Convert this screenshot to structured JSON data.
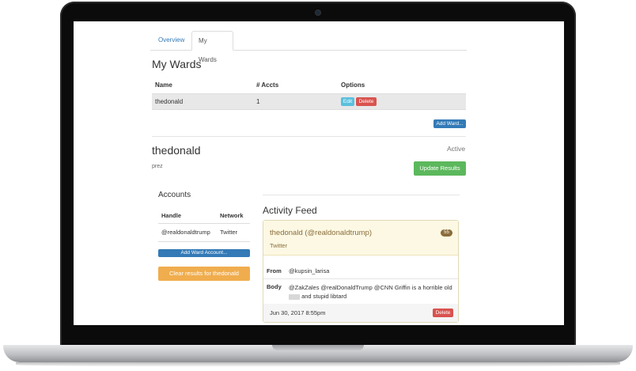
{
  "tabs": [
    {
      "label": "Overview"
    },
    {
      "label": "My Wards"
    }
  ],
  "wards": {
    "heading": "My Wards",
    "columns": [
      "Name",
      "# Accts",
      "Options"
    ],
    "rows": [
      {
        "name": "thedonald",
        "accts": "1",
        "edit_label": "Edit",
        "delete_label": "Delete"
      }
    ],
    "add_label": "Add Ward..."
  },
  "ward": {
    "title": "thedonald",
    "description": "prez",
    "status": "Active",
    "update_label": "Update Results"
  },
  "accounts": {
    "heading": "Accounts",
    "columns": [
      "Handle",
      "Network"
    ],
    "rows": [
      {
        "handle": "@realdonaldtrump",
        "network": "Twitter"
      }
    ],
    "add_label": "Add Ward Account...",
    "clear_label": "Clear results for thedonald"
  },
  "feed": {
    "heading": "Activity Feed",
    "item": {
      "title": "thedonald (@realdonaldtrump)",
      "badge": "55",
      "network": "Twitter",
      "from_label": "From",
      "from_value": "@kupsin_larisa",
      "body_label": "Body",
      "body_line1": "@ZakZales @realDonaldTrump @CNN Griffin is a horrible old",
      "body_line2": "and stupid libtard",
      "date": "Jun 30, 2017 8:55pm",
      "delete_label": "Delete"
    }
  },
  "colors": {
    "primary": "#337ab7",
    "info": "#5bc0de",
    "danger": "#d9534f",
    "success": "#5cb85c",
    "warning": "#f0ad4e",
    "panel_warning_bg": "#fcf8e3",
    "panel_warning_text": "#8a6d3b"
  }
}
